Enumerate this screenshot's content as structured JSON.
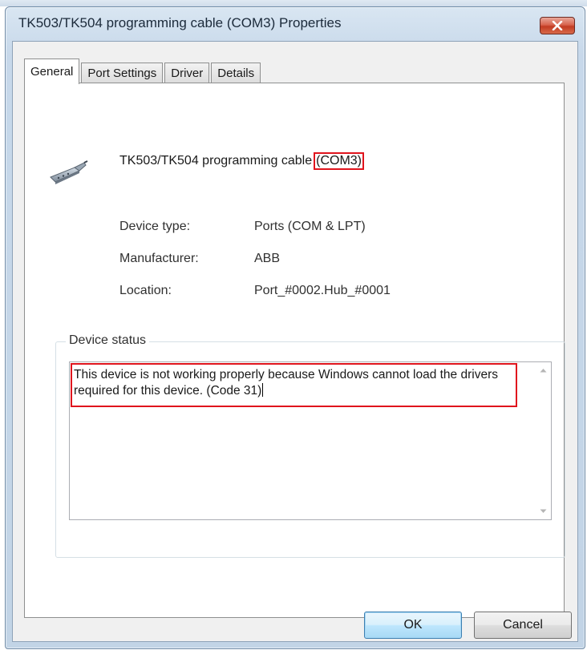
{
  "window": {
    "title": "TK503/TK504 programming cable (COM3) Properties",
    "close_icon": "close-icon"
  },
  "tabs": [
    {
      "label": "General",
      "active": true
    },
    {
      "label": "Port Settings",
      "active": false
    },
    {
      "label": "Driver",
      "active": false
    },
    {
      "label": "Details",
      "active": false
    }
  ],
  "device": {
    "icon": "serial-port-cable-icon",
    "name": "TK503/TK504 programming cable",
    "port": "(COM3)"
  },
  "properties": {
    "device_type_label": "Device type:",
    "device_type_value": "Ports (COM & LPT)",
    "manufacturer_label": "Manufacturer:",
    "manufacturer_value": "ABB",
    "location_label": "Location:",
    "location_value": "Port_#0002.Hub_#0001"
  },
  "status": {
    "legend": "Device status",
    "message": "This device is not working properly because Windows cannot load the drivers required for this device. (Code 31)"
  },
  "buttons": {
    "ok": "OK",
    "cancel": "Cancel"
  },
  "colors": {
    "highlight": "#e0141d",
    "close_button": "#c23b22",
    "title_bar": "#c7d8ea"
  }
}
